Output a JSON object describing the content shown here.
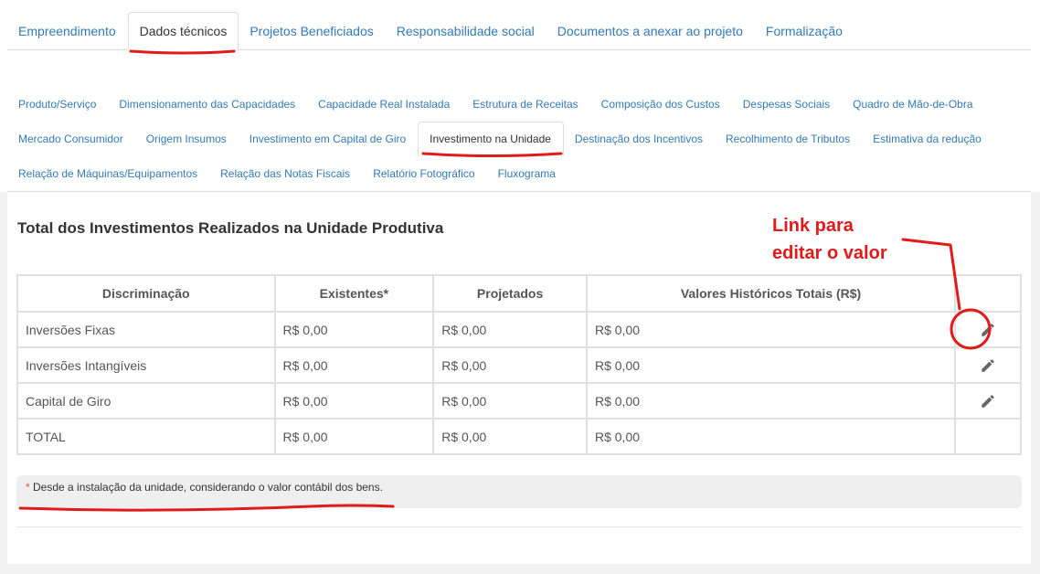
{
  "main_tabs": [
    {
      "label": "Empreendimento"
    },
    {
      "label": "Dados técnicos"
    },
    {
      "label": "Projetos Beneficiados"
    },
    {
      "label": "Responsabilidade social"
    },
    {
      "label": "Documentos a anexar ao projeto"
    },
    {
      "label": "Formalização"
    }
  ],
  "main_tab_active": "Dados técnicos",
  "sub_tabs_row1": [
    {
      "label": "Produto/Serviço"
    },
    {
      "label": "Dimensionamento das Capacidades"
    },
    {
      "label": "Capacidade Real Instalada"
    },
    {
      "label": "Estrutura de Receitas"
    },
    {
      "label": "Composição dos Custos"
    },
    {
      "label": "Despesas Sociais"
    },
    {
      "label": "Quadro de Mão-de-Obra"
    }
  ],
  "sub_tabs_row2": [
    {
      "label": "Mercado Consumidor"
    },
    {
      "label": "Origem Insumos"
    },
    {
      "label": "Investimento em Capital de Giro"
    },
    {
      "label": "Investimento na Unidade"
    },
    {
      "label": "Destinação dos Incentivos"
    },
    {
      "label": "Recolhimento de Tributos"
    },
    {
      "label": "Estimativa da redução"
    }
  ],
  "sub_tabs_row3": [
    {
      "label": "Relação de Máquinas/Equipamentos"
    },
    {
      "label": "Relação das Notas Fiscais"
    },
    {
      "label": "Relatório Fotográfico"
    },
    {
      "label": "Fluxograma"
    }
  ],
  "sub_tab_active": "Investimento na Unidade",
  "section": {
    "title": "Total dos Investimentos Realizados na Unidade Produtiva"
  },
  "table": {
    "headers": [
      "Discriminação",
      "Existentes*",
      "Projetados",
      "Valores Históricos Totais (R$)",
      ""
    ],
    "rows": [
      {
        "label": "Inversões Fixas",
        "existentes": "R$ 0,00",
        "projetados": "R$ 0,00",
        "totais": "R$ 0,00",
        "editable": true
      },
      {
        "label": "Inversões Intangíveis",
        "existentes": "R$ 0,00",
        "projetados": "R$ 0,00",
        "totais": "R$ 0,00",
        "editable": true
      },
      {
        "label": "Capital de Giro",
        "existentes": "R$ 0,00",
        "projetados": "R$ 0,00",
        "totais": "R$ 0,00",
        "editable": true
      },
      {
        "label": "TOTAL",
        "existentes": "R$ 0,00",
        "projetados": "R$ 0,00",
        "totais": "R$ 0,00",
        "editable": false
      }
    ]
  },
  "note": {
    "star": "*",
    "text": "Desde a instalação da unidade, considerando o valor contábil dos bens."
  },
  "annotation": {
    "line1": "Link para",
    "line2": "editar o valor"
  },
  "icons": {
    "edit": "pencil-icon"
  },
  "colors": {
    "link": "#337ab7",
    "annotation": "#e01b1b",
    "note_star": "#d9534f"
  }
}
